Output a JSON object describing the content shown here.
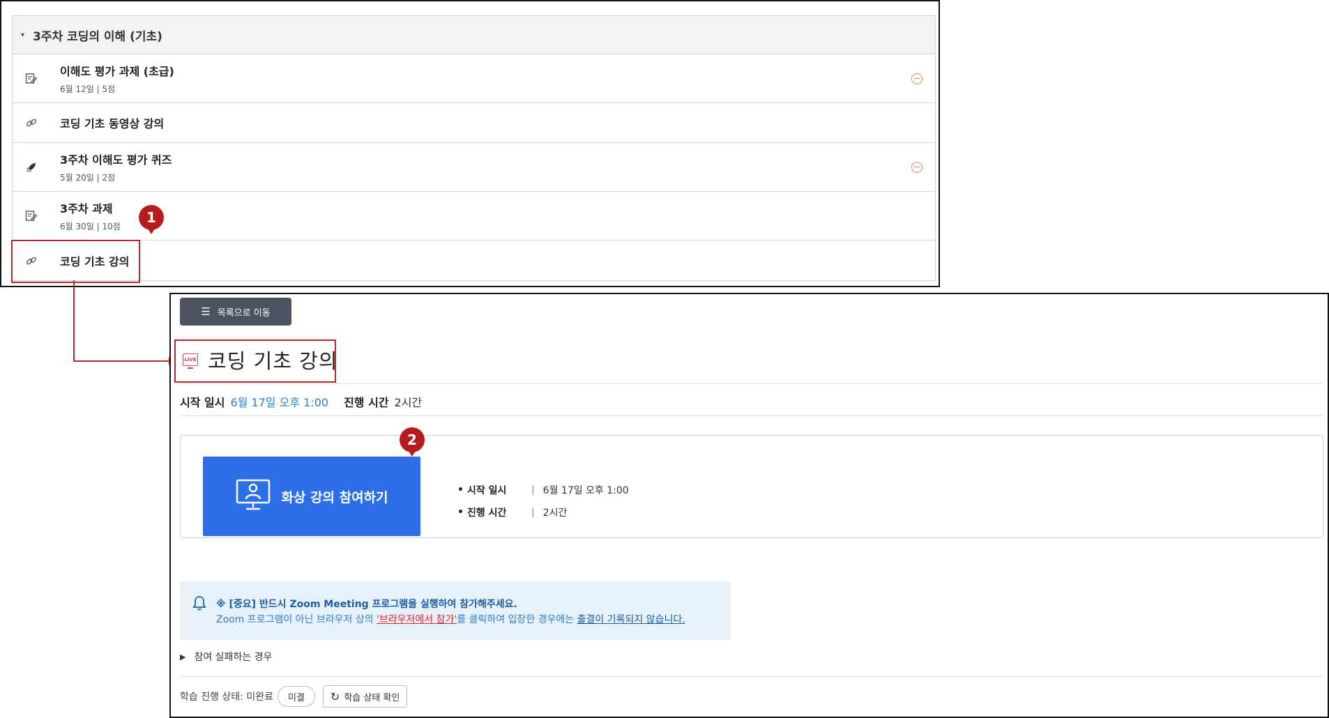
{
  "course": {
    "week_caret": "▾",
    "week_title": "3주차 코딩의 이해 (기초)",
    "activities": [
      {
        "icon": "assignment-icon",
        "name": "이해도 평가 과제 (초급)",
        "meta": "6월 12일  |  5점",
        "status": "incomplete"
      },
      {
        "icon": "link-icon",
        "name": "코딩 기초 동영상 강의",
        "meta": "",
        "status": ""
      },
      {
        "icon": "quiz-rocket-icon",
        "name": "3주차 이해도 평가 퀴즈",
        "meta": "5월 20일  |  2점",
        "status": "incomplete"
      },
      {
        "icon": "assignment-icon",
        "name": "3주차 과제",
        "meta": "6월 30일  |  10점",
        "status": ""
      },
      {
        "icon": "link-icon",
        "name": "코딩 기초 강의",
        "meta": "",
        "status": ""
      }
    ]
  },
  "annotations": {
    "badge1": "1",
    "badge2": "2",
    "highlight_color": "#b3282d"
  },
  "lecture": {
    "list_button_icon": "☰",
    "list_button_label": "목록으로 이동",
    "live_icon_text": "LIVE",
    "title": "코딩 기초 강의",
    "start_label": "시작 일시",
    "start_value": "6월 17일 오후 1:00",
    "duration_label": "진행 시간",
    "duration_value": "2시간",
    "join_button_label": "화상 강의 참여하기",
    "info": [
      {
        "label": "시작 일시",
        "value": "6월 17일 오후 1:00"
      },
      {
        "label": "진행 시간",
        "value": "2시간"
      }
    ],
    "notice": {
      "line1": "※ [중요] 반드시 Zoom Meeting 프로그램을 실행하여 참가해주세요.",
      "line2_a": "Zoom 프로그램이 아닌 브라우저 상의 ",
      "line2_link_red": "'브라우저에서 참가'",
      "line2_b": "를 클릭하여 입장한 경우에는 ",
      "line2_link_blue": "출결이 기록되지 않습니다."
    },
    "fail_toggle_icon": "▶",
    "fail_toggle_label": "참여 실패하는 경우",
    "progress_label": "학습 진행 상태: 미완료",
    "progress_pill": "미결",
    "refresh_icon": "↻",
    "check_button_label": "학습 상태 확인"
  },
  "colors": {
    "primary_blue": "#2d6fe8",
    "link_blue": "#2f7fc9",
    "warning_orange": "#e8825d",
    "dark_button": "#4c5360"
  }
}
